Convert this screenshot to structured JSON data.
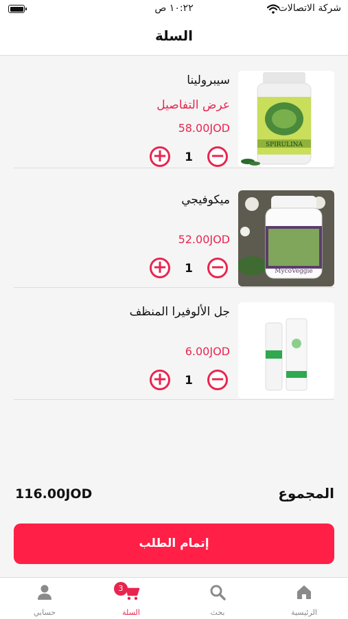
{
  "status_bar": {
    "carrier": "شركة الاتصالات",
    "time": "١٠:٢٢ ص"
  },
  "header": {
    "title": "السلة"
  },
  "cart": {
    "items": [
      {
        "name": "سيبرولينا",
        "details_link": "عرض التفاصيل",
        "price": "58.00JOD",
        "quantity": "1",
        "image_label": "SPIRULINA"
      },
      {
        "name": "ميكوفيجي",
        "price": "52.00JOD",
        "quantity": "1",
        "image_label": "MycoVeggie"
      },
      {
        "name": "جل الألوفيرا المنظف",
        "price": "6.00JOD",
        "quantity": "1"
      }
    ],
    "plus_symbol": "+",
    "minus_symbol": "−",
    "total_label": "المجموع",
    "total_value": "116.00JOD",
    "checkout_label": "إتمام الطلب"
  },
  "tabbar": {
    "tabs": [
      {
        "label": "الرئيسية",
        "icon": "home-icon"
      },
      {
        "label": "بحث",
        "icon": "search-icon"
      },
      {
        "label": "السلة",
        "icon": "cart-icon",
        "badge": "3"
      },
      {
        "label": "حسابي",
        "icon": "person-icon"
      }
    ]
  },
  "colors": {
    "accent": "#e8254f",
    "button": "#ff1f47",
    "background": "#f5f5f5"
  }
}
